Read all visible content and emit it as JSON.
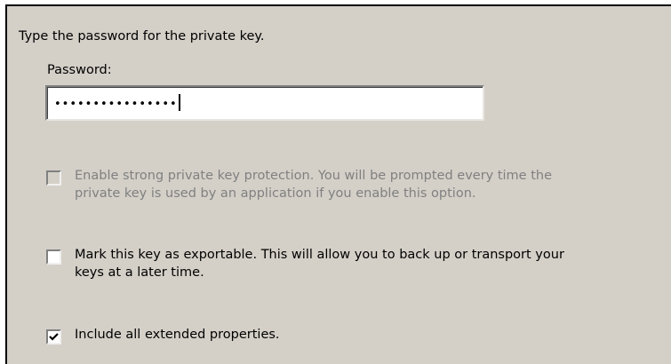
{
  "instruction": "Type the password for the private key.",
  "password": {
    "label": "Password:",
    "masked_value": "••••••••••••••••"
  },
  "options": [
    {
      "line1": "Enable strong private key protection. You will be prompted every time the",
      "line2": "private key is used by an application if you enable this option.",
      "checked": false,
      "enabled": false
    },
    {
      "line1": "Mark this key as exportable. This will allow you to back up or transport your",
      "line2": "keys at a later time.",
      "checked": false,
      "enabled": true
    },
    {
      "line1": "Include all extended properties.",
      "checked": true,
      "enabled": true
    }
  ],
  "colors": {
    "dialog_background": "#d4d0c8",
    "disabled_text": "#808080"
  }
}
